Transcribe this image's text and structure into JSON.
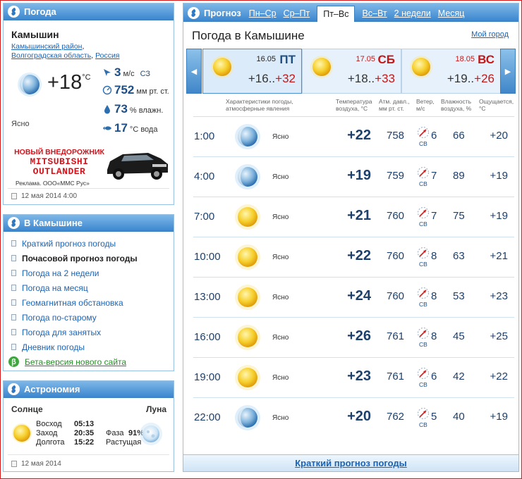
{
  "weather_panel": {
    "title": "Погода",
    "city": "Камышин",
    "region_link_1": "Камышинский район",
    "region_sep": ",",
    "region_link_2": "Волгоградская область",
    "region_link_3": "Россия",
    "temperature": "+18",
    "temp_unit": "°C",
    "condition": "Ясно",
    "wind_speed": "3",
    "wind_unit": "м/с",
    "wind_dir": "СЗ",
    "pressure": "752",
    "pressure_unit": "мм рт. ст.",
    "humidity": "73",
    "humidity_unit": "% влажн.",
    "water_temp": "17",
    "water_unit": "°С вода",
    "date": "12 мая 2014 4:00",
    "ad": {
      "line1": "НОВЫЙ ВНЕДОРОЖНИК",
      "line2": "MITSUBISHI",
      "line3": "OUTLANDER",
      "note": "Реклама. ООО«ММС Рус»"
    }
  },
  "city_panel": {
    "title": "В Камышине",
    "items": [
      {
        "label": "Краткий прогноз погоды"
      },
      {
        "label": "Почасовой прогноз погоды"
      },
      {
        "label": "Погода на 2 недели"
      },
      {
        "label": "Погода на месяц"
      },
      {
        "label": "Геомагнитная обстановка"
      },
      {
        "label": "Погода по-старому"
      },
      {
        "label": "Погода для занятых"
      },
      {
        "label": "Дневник погоды"
      },
      {
        "label": "Бета-версия нового сайта"
      }
    ],
    "beta_icon": "β"
  },
  "astro_panel": {
    "title": "Астрономия",
    "sun_label": "Солнце",
    "moon_label": "Луна",
    "sunrise_label": "Восход",
    "sunrise": "05:13",
    "sunset_label": "Заход",
    "sunset": "20:35",
    "daylength_label": "Долгота",
    "daylength": "15:22",
    "phase_label": "Фаза",
    "phase": "91%",
    "moon_state": "Растущая",
    "date": "12 мая 2014"
  },
  "forecast_panel": {
    "tab_title": "Прогноз",
    "tabs": [
      {
        "label": "Пн–Ср"
      },
      {
        "label": "Ср–Пт"
      },
      {
        "label": "Пт–Вс"
      },
      {
        "label": "Вс–Вт"
      },
      {
        "label": "2 недели"
      },
      {
        "label": "Месяц"
      }
    ],
    "title": "Погода в Камышине",
    "my_city": "Мой город",
    "nav_prev": "◀",
    "nav_next": "▶",
    "days": [
      {
        "date": "16.05",
        "name": "ПТ",
        "low": "+16..",
        "high": "+32",
        "icon": "sun-icon"
      },
      {
        "date": "17.05",
        "name": "СБ",
        "low": "+18..",
        "high": "+33",
        "icon": "sun-icon"
      },
      {
        "date": "18.05",
        "name": "ВС",
        "low": "+19..",
        "high": "+26",
        "icon": "sun-icon"
      }
    ],
    "headers": {
      "cond": "Характеристики погоды,\nатмосферные явления",
      "temp": "Температура\nвоздуха, °С",
      "press": "Атм. давл.,\nмм рт. ст.",
      "wind": "Ветер,\nм/с",
      "hum": "Влажность\nвоздуха, %",
      "feel": "Ощущается,\n°С"
    },
    "rows": [
      {
        "time": "1:00",
        "icon": "moon-icon",
        "desc": "Ясно",
        "temp": "+22",
        "press": "758",
        "wind_dir": "СВ",
        "wind": "6",
        "hum": "66",
        "feel": "+20"
      },
      {
        "time": "4:00",
        "icon": "moon-icon",
        "desc": "Ясно",
        "temp": "+19",
        "press": "759",
        "wind_dir": "СВ",
        "wind": "7",
        "hum": "89",
        "feel": "+19"
      },
      {
        "time": "7:00",
        "icon": "sun-icon",
        "desc": "Ясно",
        "temp": "+21",
        "press": "760",
        "wind_dir": "СВ",
        "wind": "7",
        "hum": "75",
        "feel": "+19"
      },
      {
        "time": "10:00",
        "icon": "sun-icon",
        "desc": "Ясно",
        "temp": "+22",
        "press": "760",
        "wind_dir": "СВ",
        "wind": "8",
        "hum": "63",
        "feel": "+21"
      },
      {
        "time": "13:00",
        "icon": "sun-icon",
        "desc": "Ясно",
        "temp": "+24",
        "press": "760",
        "wind_dir": "СВ",
        "wind": "8",
        "hum": "53",
        "feel": "+23"
      },
      {
        "time": "16:00",
        "icon": "sun-icon",
        "desc": "Ясно",
        "temp": "+26",
        "press": "761",
        "wind_dir": "СВ",
        "wind": "8",
        "hum": "45",
        "feel": "+25"
      },
      {
        "time": "19:00",
        "icon": "sun-icon",
        "desc": "Ясно",
        "temp": "+23",
        "press": "761",
        "wind_dir": "СВ",
        "wind": "6",
        "hum": "42",
        "feel": "+22"
      },
      {
        "time": "22:00",
        "icon": "moon-icon",
        "desc": "Ясно",
        "temp": "+20",
        "press": "762",
        "wind_dir": "СВ",
        "wind": "5",
        "hum": "40",
        "feel": "+19"
      }
    ],
    "footer": "Краткий прогноз погоды"
  }
}
